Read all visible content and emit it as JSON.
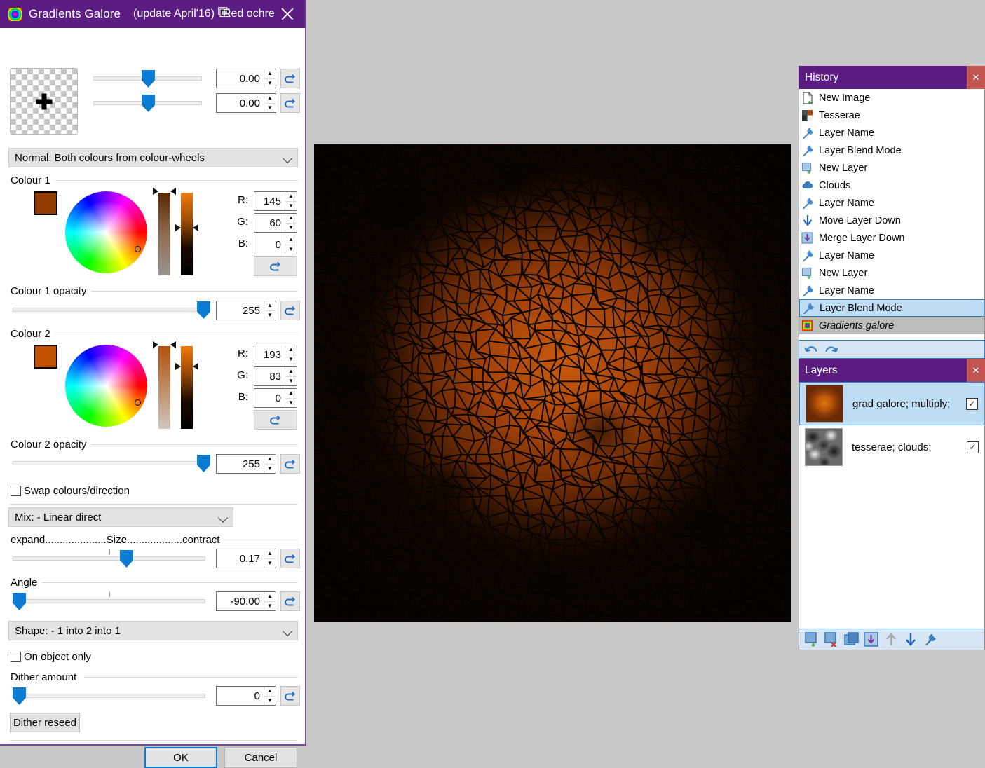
{
  "dialog": {
    "title": "Gradients Galore",
    "update": "(update April'16)",
    "preset_name": "Red ochre",
    "app_icon": "gradients-galore-icon",
    "preset_icon": "preset-monitor-icon",
    "close_icon": "close-icon"
  },
  "offsets": [
    {
      "name": "offset-x",
      "value": "0.00"
    },
    {
      "name": "offset-y",
      "value": "0.00"
    }
  ],
  "mode_combo": {
    "value": "Normal: Both colours from colour-wheels"
  },
  "colour1": {
    "group_label": "Colour 1",
    "swatch_hex": "#913c00",
    "r_label": "R:",
    "r": "145",
    "g_label": "G:",
    "g": "60",
    "b_label": "B:",
    "b": "0",
    "opacity_label": "Colour 1 opacity",
    "opacity": "255"
  },
  "colour2": {
    "group_label": "Colour 2",
    "swatch_hex": "#c15300",
    "r_label": "R:",
    "r": "193",
    "g_label": "G:",
    "g": "83",
    "b_label": "B:",
    "b": "0",
    "opacity_label": "Colour 2 opacity",
    "opacity": "255"
  },
  "swap": {
    "label": "Swap colours/direction",
    "checked": false
  },
  "mix_combo": {
    "value": "Mix: - Linear direct"
  },
  "size": {
    "label": "expand.....................Size...................contract",
    "value": "0.17"
  },
  "angle": {
    "label": "Angle",
    "value": "-90.00"
  },
  "shape_combo": {
    "value": "Shape: - 1 into 2 into 1"
  },
  "on_object_only": {
    "label": "On object only",
    "checked": false
  },
  "dither": {
    "label": "Dither amount",
    "value": "0",
    "reseed_label": "Dither reseed"
  },
  "buttons": {
    "ok": "OK",
    "cancel": "Cancel"
  },
  "history": {
    "title": "History",
    "close_icon": "close-icon",
    "items": [
      {
        "label": "New Image",
        "icon": "new-image-icon",
        "state": "normal"
      },
      {
        "label": "Tesserae",
        "icon": "tesserae-icon",
        "state": "normal"
      },
      {
        "label": "Layer Name",
        "icon": "wrench-icon",
        "state": "normal"
      },
      {
        "label": "Layer Blend Mode",
        "icon": "wrench-icon",
        "state": "normal"
      },
      {
        "label": "New Layer",
        "icon": "new-layer-icon",
        "state": "normal"
      },
      {
        "label": "Clouds",
        "icon": "cloud-icon",
        "state": "normal"
      },
      {
        "label": "Layer Name",
        "icon": "wrench-icon",
        "state": "normal"
      },
      {
        "label": "Move Layer Down",
        "icon": "arrow-down-icon",
        "state": "normal"
      },
      {
        "label": "Merge Layer Down",
        "icon": "merge-down-icon",
        "state": "normal"
      },
      {
        "label": "Layer Name",
        "icon": "wrench-icon",
        "state": "normal"
      },
      {
        "label": "New Layer",
        "icon": "new-layer-icon",
        "state": "normal"
      },
      {
        "label": "Layer Name",
        "icon": "wrench-icon",
        "state": "normal"
      },
      {
        "label": "Layer Blend Mode",
        "icon": "wrench-icon",
        "state": "selected"
      },
      {
        "label": "Gradients galore",
        "icon": "gradients-galore-icon",
        "state": "current"
      }
    ],
    "undo_icon": "undo-icon",
    "redo_icon": "redo-icon"
  },
  "layers": {
    "title": "Layers",
    "close_icon": "close-icon",
    "items": [
      {
        "name": "grad galore; multiply;",
        "visible": true,
        "selected": true,
        "thumb": "gradient-thumb"
      },
      {
        "name": "tesserae; clouds;",
        "visible": false,
        "selected": false,
        "thumb": "clouds-thumb"
      }
    ],
    "toolbar": [
      {
        "icon": "add-layer-icon"
      },
      {
        "icon": "delete-layer-icon"
      },
      {
        "icon": "duplicate-layer-icon"
      },
      {
        "icon": "merge-layer-down-icon"
      },
      {
        "icon": "move-layer-up-icon"
      },
      {
        "icon": "move-layer-down-icon"
      },
      {
        "icon": "layer-properties-icon"
      }
    ]
  },
  "colors": {
    "titlebar": "#5c1d83",
    "accent_blue": "#0b7ad1",
    "selection_blue": "#bfdcf5",
    "close_red": "#c0564f"
  }
}
